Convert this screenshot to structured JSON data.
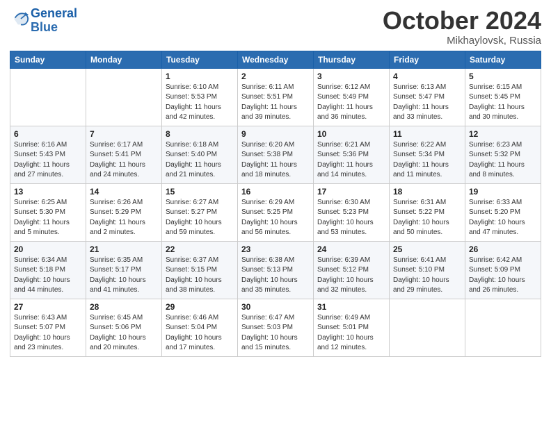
{
  "logo": {
    "text_general": "General",
    "text_blue": "Blue"
  },
  "header": {
    "month": "October 2024",
    "location": "Mikhaylovsk, Russia"
  },
  "weekdays": [
    "Sunday",
    "Monday",
    "Tuesday",
    "Wednesday",
    "Thursday",
    "Friday",
    "Saturday"
  ],
  "weeks": [
    [
      {
        "day": "",
        "info": ""
      },
      {
        "day": "",
        "info": ""
      },
      {
        "day": "1",
        "info": "Sunrise: 6:10 AM\nSunset: 5:53 PM\nDaylight: 11 hours and 42 minutes."
      },
      {
        "day": "2",
        "info": "Sunrise: 6:11 AM\nSunset: 5:51 PM\nDaylight: 11 hours and 39 minutes."
      },
      {
        "day": "3",
        "info": "Sunrise: 6:12 AM\nSunset: 5:49 PM\nDaylight: 11 hours and 36 minutes."
      },
      {
        "day": "4",
        "info": "Sunrise: 6:13 AM\nSunset: 5:47 PM\nDaylight: 11 hours and 33 minutes."
      },
      {
        "day": "5",
        "info": "Sunrise: 6:15 AM\nSunset: 5:45 PM\nDaylight: 11 hours and 30 minutes."
      }
    ],
    [
      {
        "day": "6",
        "info": "Sunrise: 6:16 AM\nSunset: 5:43 PM\nDaylight: 11 hours and 27 minutes."
      },
      {
        "day": "7",
        "info": "Sunrise: 6:17 AM\nSunset: 5:41 PM\nDaylight: 11 hours and 24 minutes."
      },
      {
        "day": "8",
        "info": "Sunrise: 6:18 AM\nSunset: 5:40 PM\nDaylight: 11 hours and 21 minutes."
      },
      {
        "day": "9",
        "info": "Sunrise: 6:20 AM\nSunset: 5:38 PM\nDaylight: 11 hours and 18 minutes."
      },
      {
        "day": "10",
        "info": "Sunrise: 6:21 AM\nSunset: 5:36 PM\nDaylight: 11 hours and 14 minutes."
      },
      {
        "day": "11",
        "info": "Sunrise: 6:22 AM\nSunset: 5:34 PM\nDaylight: 11 hours and 11 minutes."
      },
      {
        "day": "12",
        "info": "Sunrise: 6:23 AM\nSunset: 5:32 PM\nDaylight: 11 hours and 8 minutes."
      }
    ],
    [
      {
        "day": "13",
        "info": "Sunrise: 6:25 AM\nSunset: 5:30 PM\nDaylight: 11 hours and 5 minutes."
      },
      {
        "day": "14",
        "info": "Sunrise: 6:26 AM\nSunset: 5:29 PM\nDaylight: 11 hours and 2 minutes."
      },
      {
        "day": "15",
        "info": "Sunrise: 6:27 AM\nSunset: 5:27 PM\nDaylight: 10 hours and 59 minutes."
      },
      {
        "day": "16",
        "info": "Sunrise: 6:29 AM\nSunset: 5:25 PM\nDaylight: 10 hours and 56 minutes."
      },
      {
        "day": "17",
        "info": "Sunrise: 6:30 AM\nSunset: 5:23 PM\nDaylight: 10 hours and 53 minutes."
      },
      {
        "day": "18",
        "info": "Sunrise: 6:31 AM\nSunset: 5:22 PM\nDaylight: 10 hours and 50 minutes."
      },
      {
        "day": "19",
        "info": "Sunrise: 6:33 AM\nSunset: 5:20 PM\nDaylight: 10 hours and 47 minutes."
      }
    ],
    [
      {
        "day": "20",
        "info": "Sunrise: 6:34 AM\nSunset: 5:18 PM\nDaylight: 10 hours and 44 minutes."
      },
      {
        "day": "21",
        "info": "Sunrise: 6:35 AM\nSunset: 5:17 PM\nDaylight: 10 hours and 41 minutes."
      },
      {
        "day": "22",
        "info": "Sunrise: 6:37 AM\nSunset: 5:15 PM\nDaylight: 10 hours and 38 minutes."
      },
      {
        "day": "23",
        "info": "Sunrise: 6:38 AM\nSunset: 5:13 PM\nDaylight: 10 hours and 35 minutes."
      },
      {
        "day": "24",
        "info": "Sunrise: 6:39 AM\nSunset: 5:12 PM\nDaylight: 10 hours and 32 minutes."
      },
      {
        "day": "25",
        "info": "Sunrise: 6:41 AM\nSunset: 5:10 PM\nDaylight: 10 hours and 29 minutes."
      },
      {
        "day": "26",
        "info": "Sunrise: 6:42 AM\nSunset: 5:09 PM\nDaylight: 10 hours and 26 minutes."
      }
    ],
    [
      {
        "day": "27",
        "info": "Sunrise: 6:43 AM\nSunset: 5:07 PM\nDaylight: 10 hours and 23 minutes."
      },
      {
        "day": "28",
        "info": "Sunrise: 6:45 AM\nSunset: 5:06 PM\nDaylight: 10 hours and 20 minutes."
      },
      {
        "day": "29",
        "info": "Sunrise: 6:46 AM\nSunset: 5:04 PM\nDaylight: 10 hours and 17 minutes."
      },
      {
        "day": "30",
        "info": "Sunrise: 6:47 AM\nSunset: 5:03 PM\nDaylight: 10 hours and 15 minutes."
      },
      {
        "day": "31",
        "info": "Sunrise: 6:49 AM\nSunset: 5:01 PM\nDaylight: 10 hours and 12 minutes."
      },
      {
        "day": "",
        "info": ""
      },
      {
        "day": "",
        "info": ""
      }
    ]
  ]
}
